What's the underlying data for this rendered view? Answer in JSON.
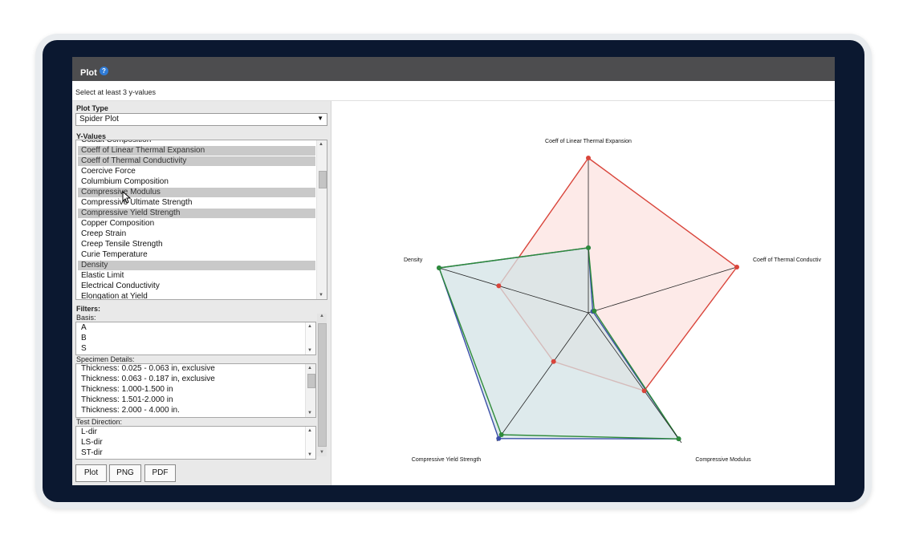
{
  "window": {
    "title": "Plot",
    "help_icon": "?"
  },
  "hint": "Select at least 3 y-values",
  "plot_type": {
    "label": "Plot Type",
    "selected": "Spider Plot",
    "arrow": "▼"
  },
  "y_values": {
    "label": "Y-Values",
    "items": [
      {
        "label": "Cobalt Composition",
        "selected": false
      },
      {
        "label": "Coeff of Linear Thermal Expansion",
        "selected": true
      },
      {
        "label": "Coeff of Thermal Conductivity",
        "selected": true
      },
      {
        "label": "Coercive Force",
        "selected": false
      },
      {
        "label": "Columbium Composition",
        "selected": false
      },
      {
        "label": "Compressive Modulus",
        "selected": true
      },
      {
        "label": "Compressive Ultimate Strength",
        "selected": false
      },
      {
        "label": "Compressive Yield Strength",
        "selected": true
      },
      {
        "label": "Copper Composition",
        "selected": false
      },
      {
        "label": "Creep Strain",
        "selected": false
      },
      {
        "label": "Creep Tensile Strength",
        "selected": false
      },
      {
        "label": "Curie Temperature",
        "selected": false
      },
      {
        "label": "Density",
        "selected": true
      },
      {
        "label": "Elastic Limit",
        "selected": false
      },
      {
        "label": "Electrical Conductivity",
        "selected": false
      },
      {
        "label": "Elongation at Yield",
        "selected": false
      }
    ]
  },
  "filters": {
    "label": "Filters:",
    "basis": {
      "label": "Basis:",
      "items": [
        "A",
        "B",
        "S"
      ]
    },
    "specimen": {
      "label": "Specimen Details:",
      "items": [
        "Thickness: 0.025 - 0.063 in, exclusive",
        "Thickness: 0.063 - 0.187 in, exclusive",
        "Thickness: 1.000-1.500 in",
        "Thickness: 1.501-2.000 in",
        "Thickness: 2.000 - 4.000 in."
      ]
    },
    "direction": {
      "label": "Test Direction:",
      "items": [
        "L-dir",
        "LS-dir",
        "ST-dir"
      ]
    }
  },
  "buttons": {
    "plot": "Plot",
    "png": "PNG",
    "pdf": "PDF"
  },
  "chart_data": {
    "type": "spider",
    "axes": [
      "Coeff of Linear Thermal Expansion",
      "Coeff of Thermal Conductiv",
      "Compressive Modulus",
      "Compressive Yield Strength",
      "Density"
    ],
    "range": [
      0,
      1
    ],
    "series": [
      {
        "color": "#d9453b",
        "fill": "#fde6e4",
        "values": [
          1.0,
          1.0,
          0.6,
          0.38,
          0.6
        ]
      },
      {
        "color": "#3b4fa8",
        "fill": "#d3e3e6",
        "values": [
          0.42,
          0.03,
          0.97,
          0.98,
          1.0
        ]
      },
      {
        "color": "#2e8b3a",
        "fill": "#d3e3e6",
        "values": [
          0.42,
          0.04,
          0.97,
          0.95,
          1.0
        ]
      }
    ]
  }
}
